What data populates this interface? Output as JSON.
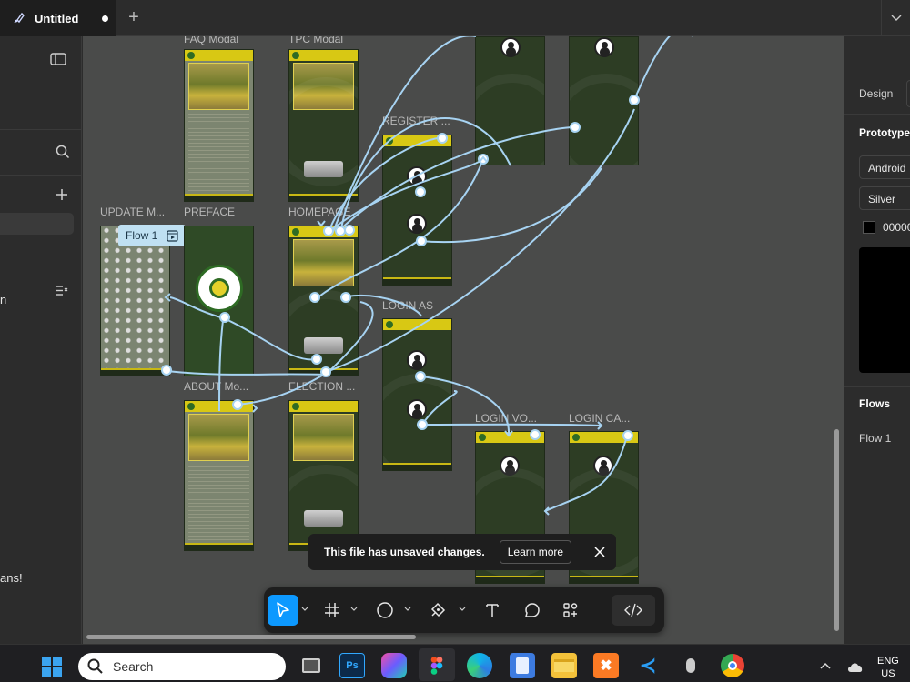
{
  "tab": {
    "title": "Untitled"
  },
  "canvas": {
    "frames": [
      {
        "label": "FAQ Modal"
      },
      {
        "label": "TPC Modal"
      },
      {
        "label": "REGISTER ..."
      },
      {
        "label": "UPDATE M..."
      },
      {
        "label": "PREFACE"
      },
      {
        "label": "HOMEPAGE"
      },
      {
        "label": "LOGIN AS"
      },
      {
        "label": "ABOUT Mo..."
      },
      {
        "label": "ELECTION ..."
      },
      {
        "label": "LOGIN VO..."
      },
      {
        "label": "LOGIN CA..."
      }
    ],
    "flow_badge": "Flow 1"
  },
  "left_panel": {
    "text_n": "n",
    "text_ans": "ans!"
  },
  "toast": {
    "message": "This file has unsaved changes.",
    "action": "Learn more"
  },
  "toolbar": {
    "tools": [
      "move",
      "frame",
      "ellipse",
      "pen",
      "text",
      "comment",
      "actions",
      "dev-mode"
    ]
  },
  "right_panel": {
    "design_tab": "Design",
    "prototype_heading": "Prototype",
    "device": "Android",
    "model": "Silver",
    "color": "00000",
    "flows_heading": "Flows",
    "flow_item": "Flow 1"
  },
  "taskbar": {
    "search_placeholder": "Search",
    "lang_1": "ENG",
    "lang_2": "US"
  },
  "colors": {
    "accent": "#0d99ff",
    "connector": "#a7d3f2",
    "frame_header": "#d8c814",
    "frame_bg": "#2d3d24"
  }
}
